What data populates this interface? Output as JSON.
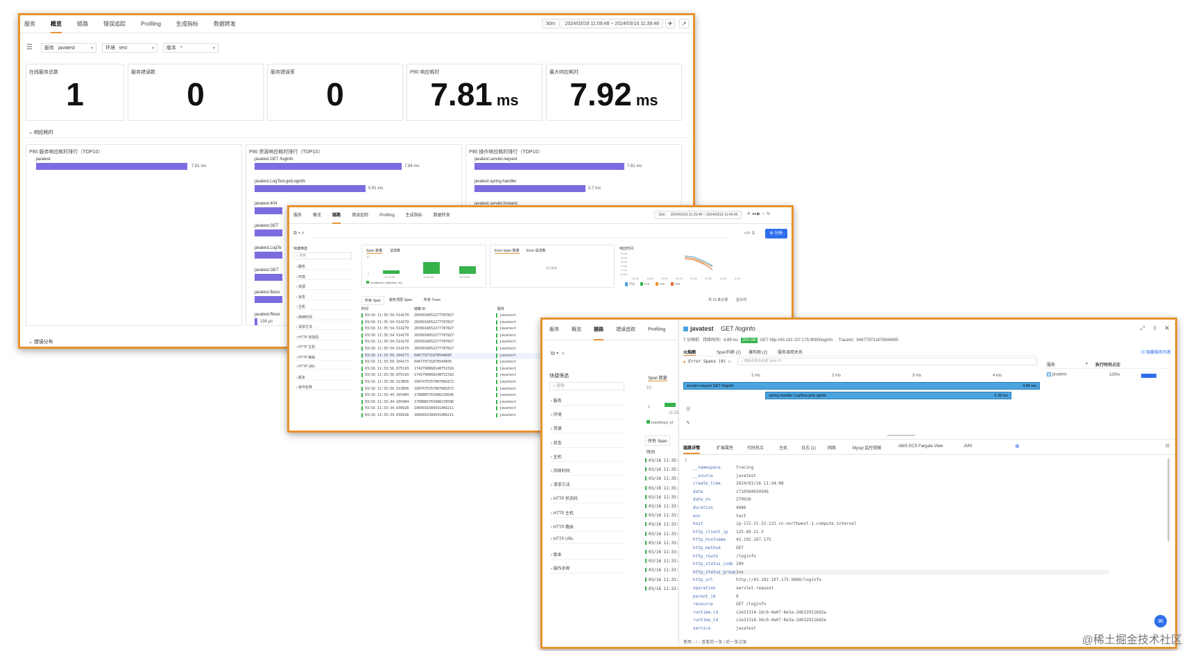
{
  "w1": {
    "tabs": [
      "服务",
      "概览",
      "链路",
      "错误追踪",
      "Profiling",
      "生成指标",
      "数据转发"
    ],
    "active_tab": 1,
    "time_range": {
      "short": "30m",
      "range": "2024/03/16 11:09:48 ~ 2024/03/16 11:39:48"
    },
    "filters": {
      "service": {
        "label": "服务",
        "value": "javatest"
      },
      "env": {
        "label": "环境",
        "value": "test"
      },
      "version": {
        "label": "版本",
        "value": "*"
      }
    },
    "stats": [
      {
        "label": "在线服务总数",
        "value": "1",
        "unit": ""
      },
      {
        "label": "服务错误数",
        "value": "0",
        "unit": ""
      },
      {
        "label": "服务错误率",
        "value": "0",
        "unit": ""
      },
      {
        "label": "P90 响应耗时",
        "value": "7.81",
        "unit": "ms"
      },
      {
        "label": "最大响应耗时",
        "value": "7.92",
        "unit": "ms"
      }
    ],
    "section_latency": "响应耗时",
    "section_errors": "错误分布",
    "charts": {
      "service": {
        "title": "P90 服务响应耗时排行（TOP10）",
        "items": [
          {
            "name": "javatest",
            "value": "7.81 ms",
            "frac": 0.7
          }
        ]
      },
      "resource": {
        "title": "P90 资源响应耗时排行（TOP10）",
        "items": [
          {
            "name": "javatest.GET /loginfo",
            "value": "7.84 ms",
            "frac": 0.72
          },
          {
            "name": "javatest.LogTest.getLoginfo",
            "value": "5.91 ms",
            "frac": 0.54
          },
          {
            "name": "javatest.404",
            "value": "",
            "frac": 0.4
          },
          {
            "name": "javatest.GET",
            "value": "",
            "frac": 0.4
          },
          {
            "name": "javatest.LogTe",
            "value": "",
            "frac": 0.4
          },
          {
            "name": "javatest.GET",
            "value": "",
            "frac": 0.4
          },
          {
            "name": "javatest.Basic",
            "value": "",
            "frac": 0.4
          },
          {
            "name": "javatest.Reso",
            "value": "158 μs",
            "frac": 0.015
          }
        ]
      },
      "operation": {
        "title": "P90 操作响应耗时排行（TOP10）",
        "items": [
          {
            "name": "javatest.servlet.request",
            "value": "7.81 ms",
            "frac": 0.72
          },
          {
            "name": "javatest.spring.handler",
            "value": "5.7 ms",
            "frac": 0.53
          },
          {
            "name": "javatest.servlet.forward",
            "value": "",
            "frac": 0.3
          }
        ]
      }
    }
  },
  "w2": {
    "tabs": [
      "服务",
      "概览",
      "链路",
      "错误追踪",
      "Profiling",
      "生成指标",
      "数据转发"
    ],
    "active_tab": 2,
    "time_range": {
      "short": "15m",
      "range": "2024/03/16 11:25:46 ~ 2024/03/16 11:40:46"
    },
    "analyze_label": "分析",
    "quick_filter": "快捷筛选",
    "search_placeholder": "搜索",
    "filter_items": [
      "服务",
      "环境",
      "资源",
      "状态",
      "主机",
      "持续时间",
      "请求方法",
      "HTTP 状态码",
      "HTTP 主机",
      "HTTP 路由",
      "HTTP URL",
      "版本",
      "操作名称"
    ],
    "span_card": {
      "tab1": "Span 数量",
      "tab2": "请求数",
      "y_top": "10",
      "y_zero": "0",
      "x_labels": [
        "11:33:20",
        "11:33:40",
        "11:35:40"
      ],
      "values": [
        2,
        6,
        4
      ],
      "legend": "count(trace_id)(status: ok)"
    },
    "error_card": {
      "tab1": "Error Span 数量",
      "tab2": "Error 请求数",
      "empty": "暂无数据"
    },
    "latency_card": {
      "title": "响应时间",
      "y_labels": [
        "5 ms",
        "4 ms",
        "3 ms",
        "2 ms",
        "1 ms",
        "0 ms"
      ],
      "x_labels": [
        "11:26",
        "11:28",
        "11:30",
        "11:32",
        "11:34",
        "11:36",
        "11:38",
        "11:40"
      ],
      "legend": [
        "平均",
        "P75",
        "P90",
        "P99"
      ]
    },
    "list_tabs": [
      "所有 Span",
      "服务顶层 Span",
      "所有 Trace"
    ],
    "count_text": "共 16 条记录",
    "show_text": "显示列",
    "columns": [
      "时间",
      "链路 ID",
      "服务"
    ],
    "rows": [
      {
        "time": "03/16 11:35:54.514279",
        "id": "2839918652277787827",
        "svc": "javatest"
      },
      {
        "time": "03/16 11:35:54.514279",
        "id": "2839918652277787827",
        "svc": "javatest"
      },
      {
        "time": "03/16 11:35:54.514279",
        "id": "2839918652277787827",
        "svc": "javatest"
      },
      {
        "time": "03/16 11:35:54.514279",
        "id": "2839918652277787827",
        "svc": "javatest"
      },
      {
        "time": "03/16 11:35:54.514279",
        "id": "2839918652277787827",
        "svc": "javatest"
      },
      {
        "time": "03/16 11:35:54.514279",
        "id": "2839918652277787827",
        "svc": "javatest"
      },
      {
        "time": "03/16 11:33:59.104273",
        "id": "646779731878544695",
        "svc": "javatest"
      },
      {
        "time": "03/16 11:33:59.104273",
        "id": "646779731878544695",
        "svc": "javatest"
      },
      {
        "time": "03/16 11:33:56.875193",
        "id": "1742790868148752316",
        "svc": "javatest"
      },
      {
        "time": "03/16 11:33:56.875193",
        "id": "1742790868148752316",
        "svc": "javatest"
      },
      {
        "time": "03/16 11:33:56.513856",
        "id": "1897475357887981672",
        "svc": "javatest"
      },
      {
        "time": "03/16 11:33:56.513856",
        "id": "1897475357887981672",
        "svc": "javatest"
      },
      {
        "time": "03/16 11:33:44.165484",
        "id": "1708865763486239596",
        "svc": "javatest"
      },
      {
        "time": "03/16 11:33:44.165484",
        "id": "1708865763486239596",
        "svc": "javatest"
      },
      {
        "time": "03/16 11:33:34.039928",
        "id": "1860916389591466211",
        "svc": "javatest"
      },
      {
        "time": "03/16 11:33:34.039928",
        "id": "1860916389591466211",
        "svc": "javatest"
      }
    ]
  },
  "w3": {
    "tabs": [
      "服务",
      "概览",
      "链路",
      "错误追踪",
      "Profiling"
    ],
    "active_tab": 2,
    "quick_filter": "快捷筛选",
    "search_placeholder": "搜索",
    "filter_items": [
      "服务",
      "环境",
      "资源",
      "状态",
      "主机",
      "持续时间",
      "请求方法",
      "HTTP 状态码",
      "HTTP 主机",
      "HTTP 路由",
      "HTTP URL",
      "版本",
      "操作名称"
    ],
    "span_tab": "Span 数量",
    "y10": "10",
    "y0": "0",
    "xlab": "11:33:2",
    "legend": "count(trace_id",
    "all_span": "所有 Span",
    "time_col": "时间",
    "rows": [
      "03/16 11:35:54.51",
      "03/16 11:35:54.51",
      "03/16 11:35:54.51",
      "03/16 11:35:54.51",
      "03/16 11:35:54.51",
      "03/16 11:33:59.10",
      "03/16 11:33:59.10",
      "03/16 11:33:56.87",
      "03/16 11:33:56.87",
      "03/16 11:33:54.51",
      "03/16 11:33:54.51",
      "03/16 11:33:44.16",
      "03/16 11:33:44.16",
      "03/16 11:33:34.03",
      "03/16 11:33:34.03"
    ],
    "detail": {
      "service": "javatest",
      "title": "GET /loginfo",
      "ago": "7 分钟前",
      "duration": "持续时间：4.89 ms",
      "status": "200 OK",
      "method": "GET",
      "url": "http://43.192.107.175:9080/loginfo",
      "trace_id": "TraceId：646779731878544695",
      "subtabs": [
        "火焰图",
        "Span列表 (2)",
        "瀑布图 (2)",
        "服务调用关系"
      ],
      "hide_service_list": "隐藏服务列表",
      "error_spans": "Error Spans (0)",
      "search_span_placeholder": "搜索资源名称或 Span ID",
      "ticks": [
        "1 ms",
        "2 ms",
        "3 ms",
        "4 ms"
      ],
      "flame": [
        {
          "label": "servlet.request GET /loginfo",
          "value": "4.89 ms",
          "start": 0,
          "frac": 1.0
        },
        {
          "label": "spring.handler LogTest.getLoginfo",
          "value": "3.38 ms",
          "start": 0.23,
          "frac": 0.69
        }
      ],
      "svc_col": "服务",
      "exec_col": "执行时间占比",
      "svc_row": {
        "name": "javatest",
        "pct": "100%"
      },
      "bottom_tabs": [
        "链路详情",
        "扩展属性",
        "代码热点",
        "主机",
        "日志 (1)",
        "网络",
        "Mysql 监控视图",
        "AWS ECS Fargate View",
        "JVM"
      ],
      "attrs": [
        {
          "k": "__namespace",
          "v": "tracing"
        },
        {
          "k": "__source",
          "v": "javatest"
        },
        {
          "k": "create_time",
          "v": "2024/03/16 11:34:08"
        },
        {
          "k": "date",
          "v": "1710560039506"
        },
        {
          "k": "date_ns",
          "v": "279920"
        },
        {
          "k": "duration",
          "v": "4886"
        },
        {
          "k": "env",
          "v": "test"
        },
        {
          "k": "host",
          "v": "ip-172-31-32-131.cn-northwest-1.compute.internal"
        },
        {
          "k": "http_client_ip",
          "v": "125.69.11.3"
        },
        {
          "k": "http_hostname",
          "v": "43.192.107.175"
        },
        {
          "k": "http_method",
          "v": "GET"
        },
        {
          "k": "http_route",
          "v": "/loginfo"
        },
        {
          "k": "http_status_code",
          "v": "200"
        },
        {
          "k": "http_status_group",
          "v": "2xx"
        },
        {
          "k": "http_url",
          "v": "http://43.192.107.175:9080/loginfo"
        },
        {
          "k": "operation",
          "v": "servlet.request"
        },
        {
          "k": "parent_id",
          "v": "0"
        },
        {
          "k": "resource",
          "v": "GET /loginfo"
        },
        {
          "k": "runtime-id",
          "v": "c2e31314-16c9-4a07-8e3a-2d6329216d2a"
        },
        {
          "k": "runtime_id",
          "v": "c2e31314-16c9-4a07-8e3a-2d6329216d2a"
        },
        {
          "k": "service",
          "v": "javatest"
        }
      ],
      "footer": "使用 ↑ / ↓ 查看前一条 / 后一条记录"
    }
  },
  "watermark": "@稀土掘金技术社区",
  "colors": {
    "accent": "#e8912d",
    "bar": "#7b6ce0",
    "flame": "#4aa3df",
    "ok": "#36b24a",
    "primary": "#2f6fed"
  }
}
